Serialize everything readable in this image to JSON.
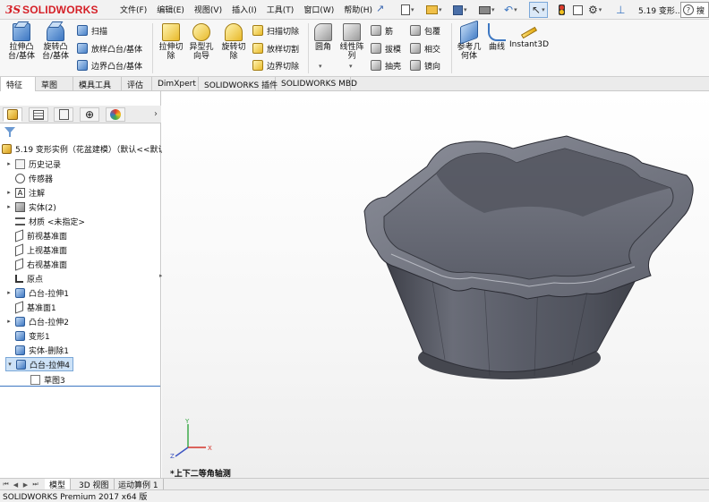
{
  "app": {
    "logo_ds": "3S",
    "logo_name": "SOLIDWORKS"
  },
  "menu": [
    "文件(F)",
    "编辑(E)",
    "视图(V)",
    "插入(I)",
    "工具(T)",
    "窗口(W)",
    "帮助(H)"
  ],
  "document_title": "5.19 变形...",
  "help_search_placeholder": "搜",
  "ribbon": {
    "extrude_boss": "拉伸凸\n台/基体",
    "revolve_boss": "旋转凸\n台/基体",
    "sweep": "扫描",
    "loft_boss": "放样凸台/基体",
    "boundary_boss": "边界凸台/基体",
    "extrude_cut": "拉伸切\n除",
    "hole_wizard": "异型孔\n向导",
    "revolve_cut": "旋转切\n除",
    "sweep_cut": "扫描切除",
    "loft_cut": "放样切割",
    "boundary_cut": "边界切除",
    "fillet": "圆角",
    "linear_pattern": "线性阵\n列",
    "rib": "筋",
    "draft": "拔模",
    "shell": "抽壳",
    "wrap": "包覆",
    "intersect": "相交",
    "mirror": "镜向",
    "reference_geometry": "参考几\n何体",
    "curves": "曲线",
    "instant3d": "Instant3D"
  },
  "command_tabs": [
    "特征",
    "草图",
    "模具工具",
    "评估",
    "DimXpert",
    "SOLIDWORKS 插件",
    "SOLIDWORKS MBD"
  ],
  "feature_tree": {
    "root": "5.19 变形实例（花盆建模）（默认<<默认",
    "items": [
      {
        "label": "历史记录",
        "expand": "▸"
      },
      {
        "label": "传感器",
        "expand": ""
      },
      {
        "label": "注解",
        "expand": "▸"
      },
      {
        "label": "实体(2)",
        "expand": "▸"
      },
      {
        "label": "材质 <未指定>",
        "expand": ""
      },
      {
        "label": "前视基准面",
        "expand": ""
      },
      {
        "label": "上视基准面",
        "expand": ""
      },
      {
        "label": "右视基准面",
        "expand": ""
      },
      {
        "label": "原点",
        "expand": ""
      },
      {
        "label": "凸台-拉伸1",
        "expand": "▸"
      },
      {
        "label": "基准面1",
        "expand": ""
      },
      {
        "label": "凸台-拉伸2",
        "expand": "▸"
      },
      {
        "label": "变形1",
        "expand": ""
      },
      {
        "label": "实体-删除1",
        "expand": ""
      },
      {
        "label": "凸台-拉伸4",
        "expand": "▾"
      },
      {
        "label": "草图3",
        "expand": ""
      }
    ]
  },
  "view_orientation": "*上下二等角轴测",
  "triad": {
    "x": "X",
    "y": "Y",
    "z": "Z"
  },
  "bottom_tabs": [
    "模型",
    "3D 视图",
    "运动算例 1"
  ],
  "status": "SOLIDWORKS Premium 2017 x64 版",
  "colors": {
    "brand": "#d51f26",
    "accent": "#3d77c2",
    "model": "#5a5d68"
  }
}
